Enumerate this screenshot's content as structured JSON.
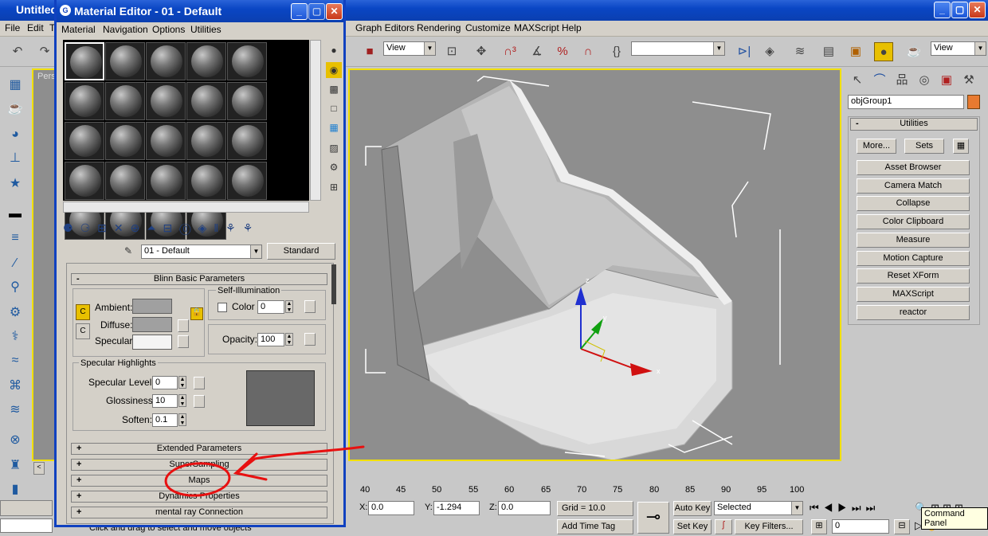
{
  "main_window": {
    "title": "Untitled",
    "menu": [
      "File",
      "Edit",
      "T",
      "Graph Editors",
      "Rendering",
      "Customize",
      "MAXScript",
      "Help"
    ],
    "toolbar": {
      "view_dropdown_1": "View",
      "view_dropdown_2": "View"
    }
  },
  "viewport": {
    "label": "Pers",
    "axis_x": "x",
    "axis_z": "z",
    "axis_y": "y"
  },
  "command_panel": {
    "object_name": "objGroup1",
    "rollout_title": "Utilities",
    "more_label": "More...",
    "sets_label": "Sets",
    "utilities": [
      "Asset Browser",
      "Camera Match",
      "Collapse",
      "Color Clipboard",
      "Measure",
      "Motion Capture",
      "Reset XForm",
      "MAXScript",
      "reactor"
    ]
  },
  "timeline": {
    "ticks": [
      "40",
      "45",
      "50",
      "55",
      "60",
      "65",
      "70",
      "75",
      "80",
      "85",
      "90",
      "95",
      "100"
    ]
  },
  "status": {
    "x_label": "X:",
    "x_value": "0.0",
    "y_label": "Y:",
    "y_value": "-1.294",
    "z_label": "Z:",
    "z_value": "0.0",
    "grid": "Grid = 10.0",
    "auto_key": "Auto Key",
    "set_key": "Set Key",
    "selected": "Selected",
    "key_filters": "Key Filters...",
    "frame": "0",
    "add_time_tag": "Add Time Tag",
    "prompt": "Click and drag to select and move objects",
    "tooltip": "Command Panel"
  },
  "material_editor": {
    "title": "Material Editor - 01 - Default",
    "menu": [
      "Material",
      "Navigation",
      "Options",
      "Utilities"
    ],
    "material_name": "01 - Default",
    "material_type": "Standard",
    "blinn": {
      "title": "Blinn Basic Parameters",
      "self_illum_title": "Self-Illumination",
      "ambient_label": "Ambient:",
      "diffuse_label": "Diffuse:",
      "specular_label": "Specular:",
      "color_label": "Color",
      "color_value": "0",
      "opacity_label": "Opacity:",
      "opacity_value": "100"
    },
    "specular_highlights": {
      "title": "Specular Highlights",
      "level_label": "Specular Level:",
      "level_value": "0",
      "gloss_label": "Glossiness:",
      "gloss_value": "10",
      "soften_label": "Soften:",
      "soften_value": "0.1"
    },
    "rollouts": [
      "Extended Parameters",
      "SuperSampling",
      "Maps",
      "Dynamics Properties",
      "mental ray Connection"
    ]
  },
  "annotation": {
    "color": "#e81010"
  }
}
